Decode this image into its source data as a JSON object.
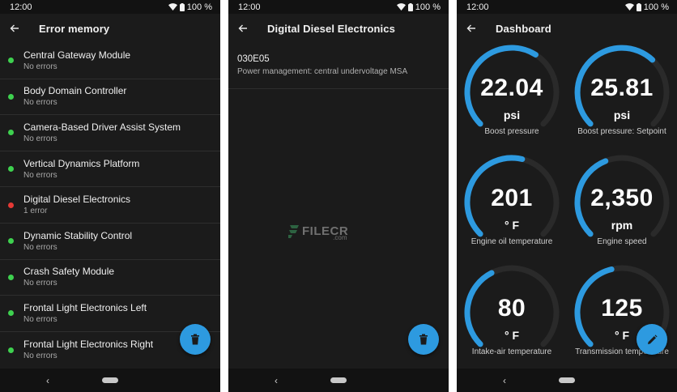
{
  "status": {
    "time": "12:00",
    "battery": "100 %"
  },
  "screens": {
    "error_memory": {
      "title": "Error memory",
      "items": [
        {
          "name": "Central Gateway Module",
          "status": "No errors",
          "color": "#3ed14f"
        },
        {
          "name": "Body Domain Controller",
          "status": "No errors",
          "color": "#3ed14f"
        },
        {
          "name": "Camera-Based Driver Assist System",
          "status": "No errors",
          "color": "#3ed14f"
        },
        {
          "name": "Vertical Dynamics Platform",
          "status": "No errors",
          "color": "#3ed14f"
        },
        {
          "name": "Digital Diesel Electronics",
          "status": "1 error",
          "color": "#e53935"
        },
        {
          "name": "Dynamic Stability Control",
          "status": "No errors",
          "color": "#3ed14f"
        },
        {
          "name": "Crash Safety Module",
          "status": "No errors",
          "color": "#3ed14f"
        },
        {
          "name": "Frontal Light Electronics Left",
          "status": "No errors",
          "color": "#3ed14f"
        },
        {
          "name": "Frontal Light Electronics Right",
          "status": "No errors",
          "color": "#3ed14f"
        }
      ],
      "fab_icon": "delete-icon"
    },
    "ecu_detail": {
      "title": "Digital Diesel Electronics",
      "faults": [
        {
          "code": "030E05",
          "description": "Power management: central undervoltage MSA"
        }
      ],
      "fab_icon": "delete-icon"
    },
    "dashboard": {
      "title": "Dashboard",
      "gauges": [
        {
          "value": "22.04",
          "unit": "psi",
          "label": "Boost pressure",
          "fill": 0.62
        },
        {
          "value": "25.81",
          "unit": "psi",
          "label": "Boost pressure: Setpoint",
          "fill": 0.66
        },
        {
          "value": "201",
          "unit": "° F",
          "label": "Engine oil temperature",
          "fill": 0.55
        },
        {
          "value": "2,350",
          "unit": "rpm",
          "label": "Engine speed",
          "fill": 0.42
        },
        {
          "value": "80",
          "unit": "° F",
          "label": "Intake-air temperature",
          "fill": 0.4
        },
        {
          "value": "125",
          "unit": "° F",
          "label": "Transmission temperature",
          "fill": 0.45
        }
      ],
      "fab_icon": "edit-icon"
    }
  },
  "watermark": {
    "text": "FILECR",
    "domain": ".com"
  },
  "colors": {
    "accent": "#2d9ae0",
    "ok": "#3ed14f",
    "error": "#e53935",
    "track": "#2a2a2a"
  }
}
